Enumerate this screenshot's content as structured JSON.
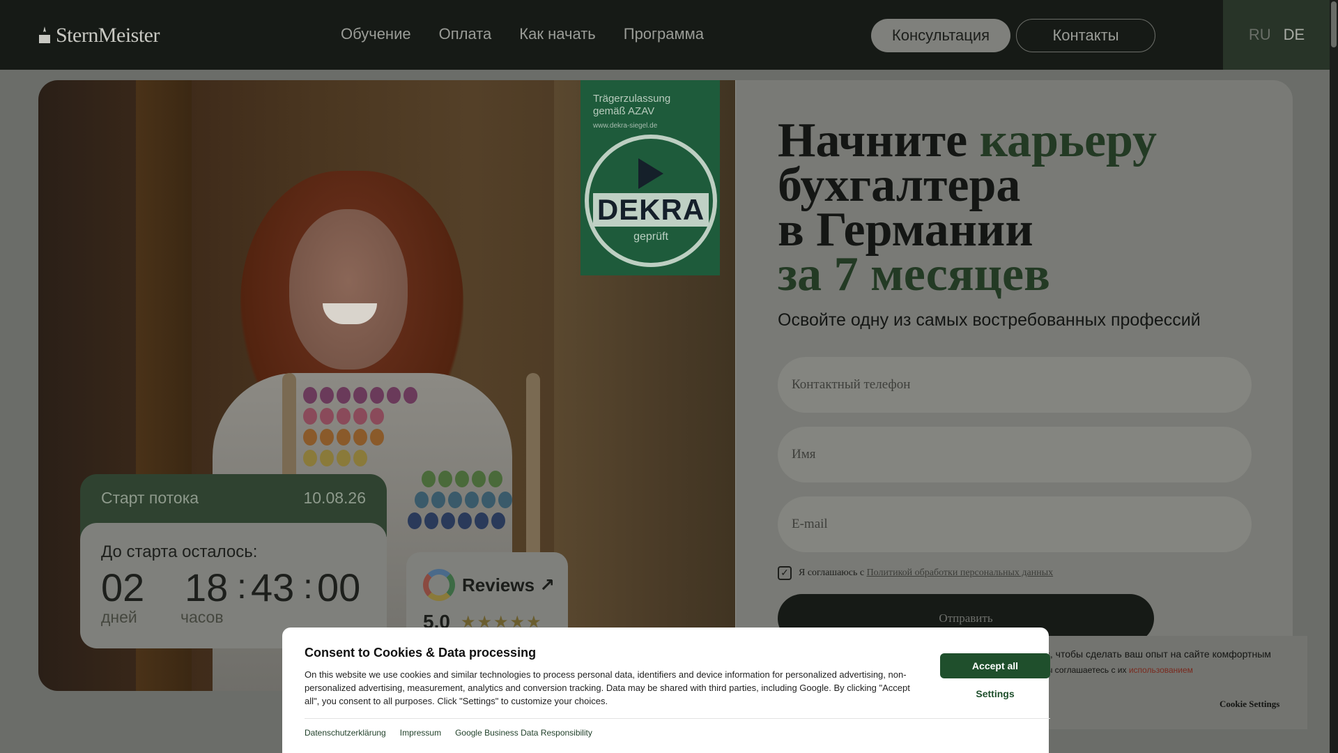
{
  "header": {
    "logo": "SternMeister",
    "nav": [
      "Обучение",
      "Оплата",
      "Как начать",
      "Программа"
    ],
    "consult_label": "Консультация",
    "contacts_label": "Контакты",
    "lang_ru": "RU",
    "lang_de": "DE"
  },
  "hero": {
    "badge": {
      "title_line1": "Trägerzulassung",
      "title_line2": "gemäß AZAV",
      "url": "www.dekra-siegel.de",
      "brand": "DEKRA",
      "sub": "geprüft"
    },
    "stream": {
      "label": "Старт потока",
      "date": "10.08.26"
    },
    "countdown": {
      "title": "До старта осталось:",
      "days": "02",
      "hours": "18",
      "minutes": "43",
      "seconds": "00",
      "days_label": "дней",
      "hours_label": "часов"
    },
    "reviews": {
      "label": "Reviews",
      "rating": "5.0",
      "stars": "★★★★★"
    }
  },
  "form": {
    "headline_part1": "Начните ",
    "headline_accent1": "карьеру",
    "headline_part2": "бухгалтера",
    "headline_part3": "в Германии",
    "headline_accent2": "за 7 месяцев",
    "subhead": "Освойте одну из самых востребованных профессий",
    "phone_placeholder": "Контактный телефон",
    "name_placeholder": "Имя",
    "email_placeholder": "E-mail",
    "agree_text": "Я соглашаюсь с ",
    "agree_link": "Политикой обработки персональных данных",
    "agree_checked": true,
    "submit_label": "Отправить"
  },
  "cookie_banner_secondary": {
    "line1": "kies, чтобы сделать ваш опыт на сайте комфортным",
    "line2_prefix": "», вы соглашаетесь с их ",
    "line2_link": "использованием",
    "settings_label": "Cookie Settings"
  },
  "consent": {
    "title": "Consent to Cookies & Data processing",
    "body": "On this website we use cookies and similar technologies to process personal data, identifiers and device information for personalized advertising, non-personalized advertising, measurement, analytics and conversion tracking. Data may be shared with third parties, including Google. By clicking \"Accept all\", you consent to all purposes. Click \"Settings\" to customize your choices.",
    "accept_label": "Accept all",
    "settings_label": "Settings",
    "links": [
      "Datenschutzerklärung",
      "Impressum",
      "Google Business Data Responsibility"
    ]
  },
  "colors": {
    "header_bg": "#161a16",
    "accent_green": "#233a24",
    "consent_accept": "#1f4f2c"
  }
}
